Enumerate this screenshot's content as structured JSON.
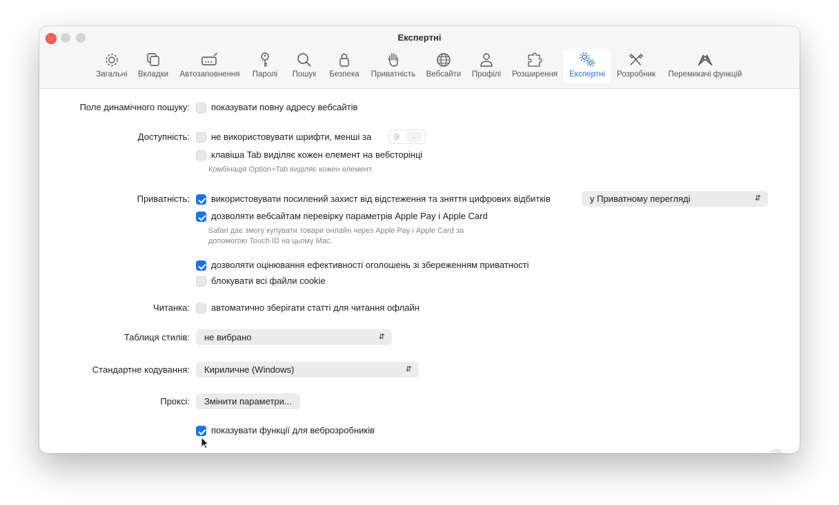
{
  "window": {
    "title": "Експертні"
  },
  "tabs": [
    {
      "label": "Загальні",
      "icon": "gear-icon"
    },
    {
      "label": "Вкладки",
      "icon": "tabs-icon"
    },
    {
      "label": "Автозаповнення",
      "icon": "autofill-icon"
    },
    {
      "label": "Паролі",
      "icon": "key-icon"
    },
    {
      "label": "Пошук",
      "icon": "search-icon"
    },
    {
      "label": "Безпека",
      "icon": "lock-icon"
    },
    {
      "label": "Приватність",
      "icon": "hand-icon"
    },
    {
      "label": "Вебсайти",
      "icon": "globe-icon"
    },
    {
      "label": "Профілі",
      "icon": "person-icon"
    },
    {
      "label": "Розширення",
      "icon": "puzzle-icon"
    },
    {
      "label": "Експертні",
      "icon": "gears-icon",
      "active": true
    },
    {
      "label": "Розробник",
      "icon": "tools-icon"
    },
    {
      "label": "Перемикачі функцій",
      "icon": "flags-icon"
    }
  ],
  "settings": {
    "smart_search": {
      "label": "Поле динамічного пошуку:",
      "option": "показувати повну адресу вебсайтів",
      "checked": false
    },
    "accessibility": {
      "label": "Доступність:",
      "min_font_option": "не використовувати шрифти, менші за",
      "min_font_value": "9",
      "tab_option": "клавіша Tab виділяє кожен елемент на вебсторінці",
      "tab_help": "Комбінація Option+Tab виділяє кожен елемент."
    },
    "privacy": {
      "label": "Приватність:",
      "tracking_option": "використовувати посилений захист від відстеження та зняття цифрових відбитків",
      "tracking_select": "у Приватному перегляді",
      "applepay_option": "дозволяти вебсайтам перевірку параметрів Apple Pay і Apple Card",
      "applepay_help_1": "Safari дає змогу купувати товари онлайн через Apple Pay і Apple Card за",
      "applepay_help_2": "допомогою Touch ID на цьому Mac.",
      "ads_option": "дозволяти оцінювання ефективності оголошень зі збереженням приватності",
      "cookies_option": "блокувати всі файли cookie"
    },
    "reader": {
      "label": "Читанка:",
      "option": "автоматично зберігати статті для читання офлайн"
    },
    "stylesheet": {
      "label": "Таблиця стилів:",
      "value": "не вибрано"
    },
    "encoding": {
      "label": "Стандартне кодування:",
      "value": "Кириличне (Windows)"
    },
    "proxies": {
      "label": "Проксі:",
      "button": "Змінити параметри..."
    },
    "developer": {
      "option": "показувати функції для веброзробників"
    }
  },
  "help_button": "?",
  "colors": {
    "accent": "#1a73e8",
    "close": "#ff5f57"
  }
}
